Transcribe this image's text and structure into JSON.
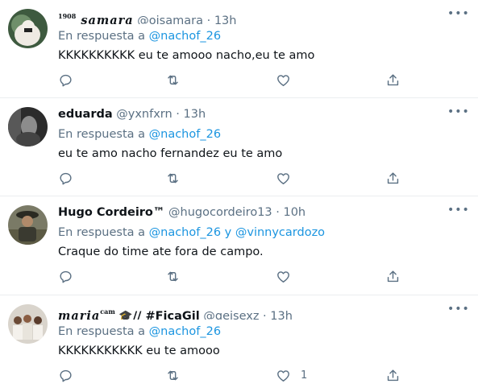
{
  "tweets": [
    {
      "name_sup": "1908",
      "name": "samara",
      "handle": "@oisamara",
      "dot": "·",
      "time": "13h",
      "reply_prefix": "En respuesta a",
      "mentions": [
        "@nachof_26"
      ],
      "text": "KKKKKKKKKK eu te amooo nacho,eu te amo"
    },
    {
      "name": "eduarda",
      "handle": "@yxnfxrn",
      "dot": "·",
      "time": "13h",
      "reply_prefix": "En respuesta a",
      "mentions": [
        "@nachof_26"
      ],
      "text": "eu te amo nacho fernandez eu te amo"
    },
    {
      "name": "Hugo Cordeiro™",
      "handle": "@hugocordeiro13",
      "dot": "·",
      "time": "10h",
      "reply_prefix": "En respuesta a",
      "mentions": [
        "@nachof_26",
        "@vinnycardozo"
      ],
      "joiner": "y",
      "text": "Craque do time ate fora de campo."
    },
    {
      "name": "maria",
      "name_sup": "cam",
      "name_tail": "// #FicaGil",
      "handle": "@geisexz",
      "dot": "·",
      "time": "13h",
      "reply_prefix": "En respuesta a",
      "mentions": [
        "@nachof_26"
      ],
      "text": "KKKKKKKKKKK eu te amooo",
      "like_count": "1"
    }
  ],
  "icons": {
    "reply": "reply-icon",
    "retweet": "retweet-icon",
    "like": "heart-icon",
    "share": "share-icon",
    "more": "more-icon",
    "graduation": "graduation-cap-icon"
  },
  "colors": {
    "text": "#0f1419",
    "muted": "#5b7083",
    "link": "#1b95e0",
    "divider": "#ebeef0"
  }
}
